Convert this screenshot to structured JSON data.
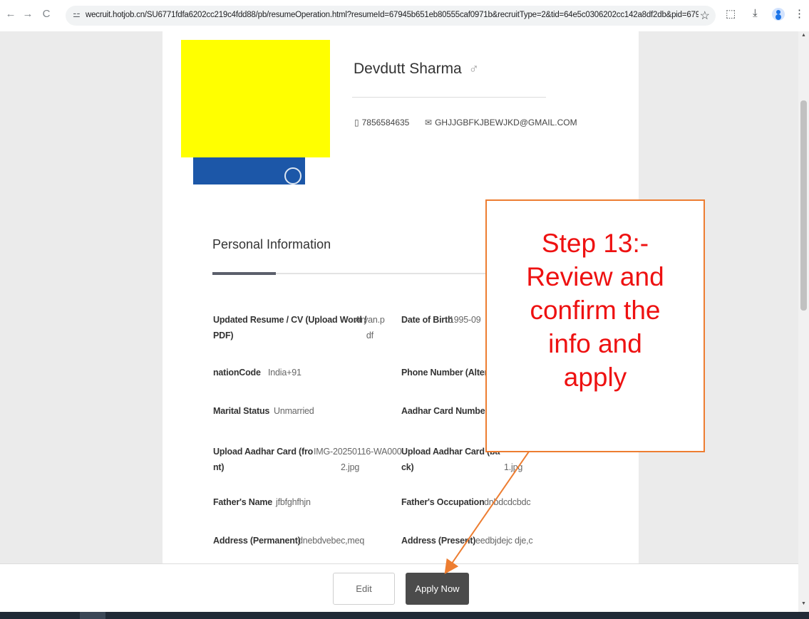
{
  "browser": {
    "url": "wecruit.hotjob.cn/SU6771fdfa6202cc219c4fdd88/pb/resumeOperation.html?resumeId=67945b651eb80555caf0971b&recruitType=2&tid=64e5c0306202cc142a8df2db&pid=6790a7c01c2...",
    "icons": {
      "back": "←",
      "forward": "→",
      "reload": "C",
      "site_info": "⚍",
      "bookmark": "☆",
      "extensions": "⬚",
      "download": "⤓",
      "menu": "⋮"
    }
  },
  "profile": {
    "name": "Devdutt Sharma",
    "gender_symbol": "♂",
    "phone": "7856584635",
    "email": "GHJJGBFKJBEWJKD@GMAIL.COM",
    "phone_icon": "▯",
    "email_icon": "✉"
  },
  "section": {
    "title": "Personal Information"
  },
  "fields": {
    "resume_label_1": "Updated Resume / CV (Upload Word /",
    "resume_label_2": "PDF)",
    "resume_value_1": "Aryan.p",
    "resume_value_2": "df",
    "dob_label": "Date of Birth",
    "dob_value": "1995-09",
    "nation_label": "nationCode",
    "nation_value": "India+91",
    "alt_phone_label": "Phone Number (Alternate",
    "marital_label": "Marital Status",
    "marital_value": "Unmarried",
    "aadhar_label": "Aadhar Card Number",
    "aadhar_front_label_1": "Upload Aadhar Card  (fro",
    "aadhar_front_label_2": "nt)",
    "aadhar_front_value_1": "IMG-20250116-WA000",
    "aadhar_front_value_2": "2.jpg",
    "aadhar_back_label_1": "Upload Aadhar Card  (ba",
    "aadhar_back_label_2": "ck)",
    "aadhar_back_value": "1.jpg",
    "father_name_label": "Father's Name",
    "father_name_value": "jfbfghfhjn",
    "father_occ_label": "Father's Occupation",
    "father_occ_value": "dnbdcdcbdc",
    "addr_perm_label": "Address (Permanent)",
    "addr_perm_value": "dnebdvebec,meq",
    "addr_pres_label": "Address (Present)",
    "addr_pres_value": "eedbjdejc dje,c"
  },
  "actions": {
    "edit_label": "Edit",
    "apply_label": "Apply Now"
  },
  "callout": {
    "line1": "Step 13:-",
    "line2": "Review and",
    "line3": "confirm the",
    "line4": "info and",
    "line5": "apply"
  },
  "colors": {
    "callout_border": "#ed7d31",
    "callout_text": "#ee1111",
    "apply_button": "#4b4b4b",
    "redaction": "#ffff00"
  }
}
